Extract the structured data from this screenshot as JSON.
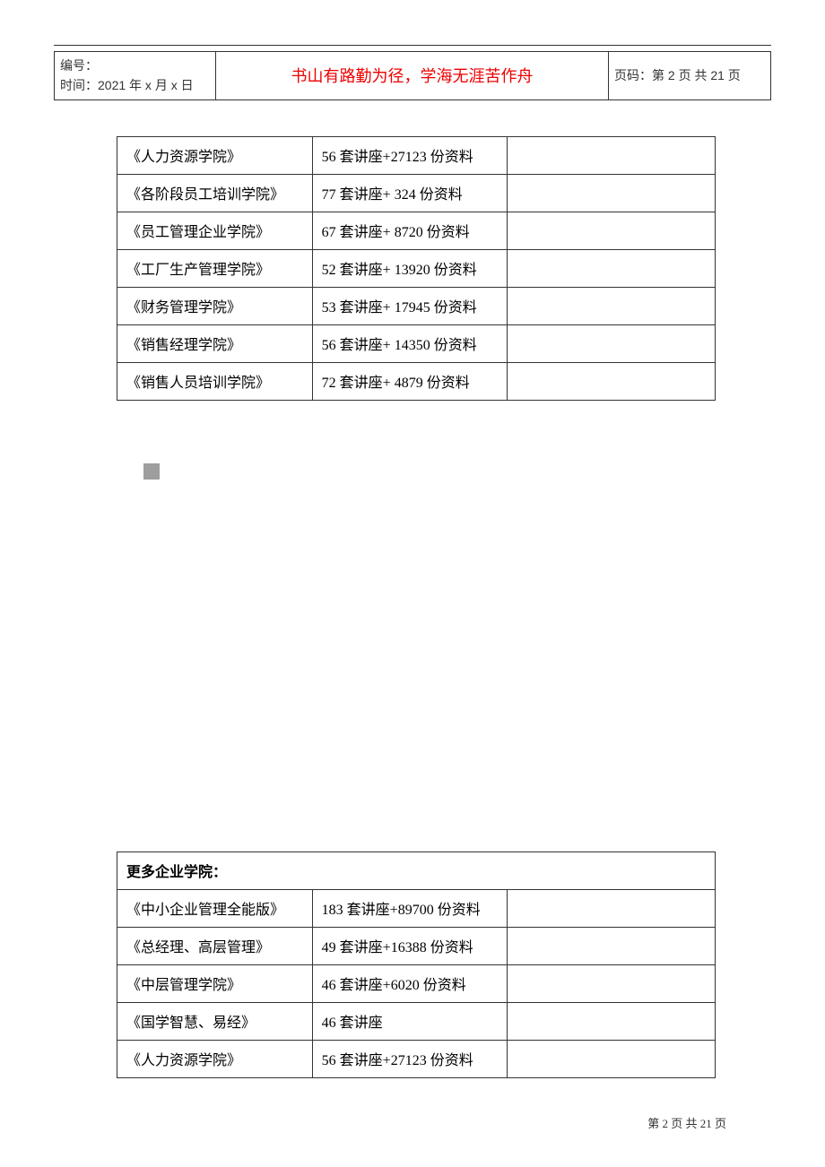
{
  "header": {
    "id_label": "编号：",
    "time_label": "时间：2021 年 x 月 x 日",
    "motto": "书山有路勤为径，学海无涯苦作舟",
    "page_label": "页码：第 2 页 共 21 页"
  },
  "table1": {
    "rows": [
      {
        "name": "《人力资源学院》",
        "desc": "56 套讲座+27123 份资料"
      },
      {
        "name": "《各阶段员工培训学院》",
        "desc": "77 套讲座+ 324 份资料"
      },
      {
        "name": "《员工管理企业学院》",
        "desc": "67 套讲座+ 8720 份资料"
      },
      {
        "name": "《工厂生产管理学院》",
        "desc": "52 套讲座+ 13920 份资料"
      },
      {
        "name": "《财务管理学院》",
        "desc": "53 套讲座+ 17945 份资料"
      },
      {
        "name": "《销售经理学院》",
        "desc": "56 套讲座+ 14350 份资料"
      },
      {
        "name": "《销售人员培训学院》",
        "desc": "72 套讲座+ 4879 份资料"
      }
    ]
  },
  "table2": {
    "header": "更多企业学院：",
    "rows": [
      {
        "name": "《中小企业管理全能版》",
        "desc": "183 套讲座+89700 份资料"
      },
      {
        "name": "《总经理、高层管理》",
        "desc": "49 套讲座+16388 份资料"
      },
      {
        "name": "《中层管理学院》",
        "desc": "46 套讲座+6020 份资料"
      },
      {
        "name": "《国学智慧、易经》",
        "desc": "46 套讲座"
      },
      {
        "name": "《人力资源学院》",
        "desc": "56 套讲座+27123 份资料"
      }
    ]
  },
  "footer": {
    "text": "第 2 页 共 21 页"
  }
}
